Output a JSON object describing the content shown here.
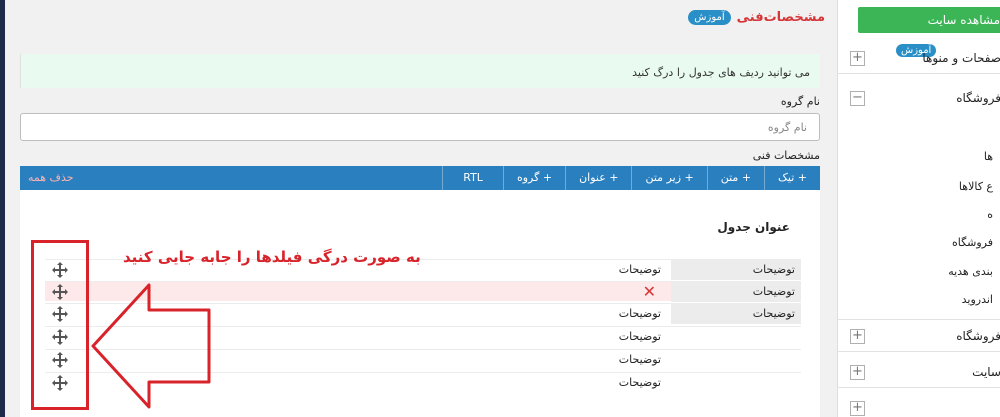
{
  "page": {
    "title": "مشخصات‌فنی",
    "tutorial_badge": "آموزش"
  },
  "notice": "می توانید ردیف های جدول را درگ کنید",
  "group": {
    "label": "نام گروه",
    "placeholder": "نام گروه"
  },
  "specs": {
    "label": "مشخصات فنی",
    "toolbar": [
      "+ تیک",
      "+ متن",
      "+ زیر متن",
      "+ عنوان",
      "+ گروه",
      "RTL"
    ],
    "delete_all": "حذف همه",
    "table_title": "عنوان جدول",
    "rows": [
      {
        "cell_a": "توضیحات",
        "cell_b": "توضیحات",
        "highlight": false,
        "removed": false
      },
      {
        "cell_a": "توضیحات",
        "cell_b": "",
        "highlight": true,
        "removed": true
      },
      {
        "cell_a": "توضیحات",
        "cell_b": "توضیحات",
        "highlight": false,
        "removed": false
      },
      {
        "cell_a": "",
        "cell_b": "توضیحات",
        "highlight": false,
        "removed": false
      },
      {
        "cell_a": "",
        "cell_b": "توضیحات",
        "highlight": false,
        "removed": false
      },
      {
        "cell_a": "",
        "cell_b": "توضیحات",
        "highlight": false,
        "removed": false
      }
    ],
    "remove_symbol": "✕"
  },
  "annotation": "به صورت درگی فیلدها را جابه جایی کنید",
  "sidebar": {
    "view_site": "مشاهده سایت",
    "sections": [
      {
        "label": "صفحات و منوها",
        "toggle": "+",
        "badge": "آموزش"
      },
      {
        "label": "فروشگاه",
        "toggle": "−",
        "badge": ""
      },
      {
        "label": "فروشگاه",
        "toggle": "+",
        "badge": ""
      },
      {
        "label": "سایت",
        "toggle": "+",
        "badge": ""
      },
      {
        "label": "",
        "toggle": "+",
        "badge": ""
      }
    ],
    "sub_items": [
      "ها",
      "ع کالاها",
      "ه",
      "فروشگاه",
      "بندی هدیه",
      "اندروید"
    ]
  },
  "colors": {
    "accent": "#2a7fbf",
    "danger": "#d8232a",
    "success": "#3cb557",
    "notice_bg": "#e9fbf0"
  }
}
